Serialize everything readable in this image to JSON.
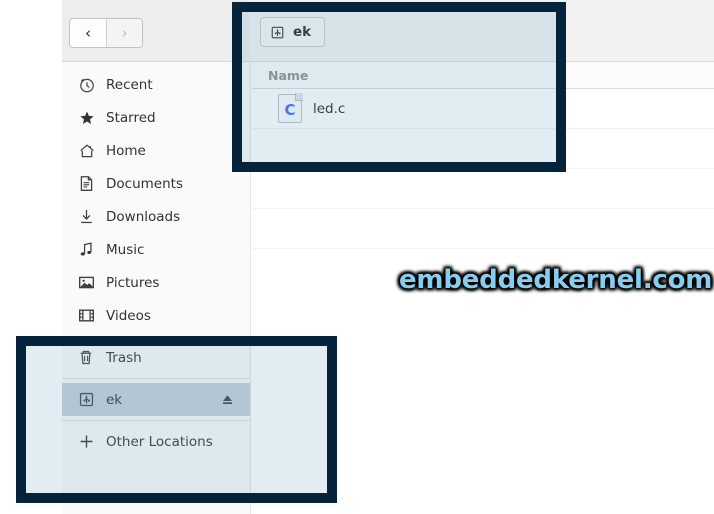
{
  "window": {
    "toolbar": {
      "back_label": "‹",
      "forward_label": "›",
      "back_icon": "chevron-left-icon",
      "forward_icon": "chevron-right-icon"
    }
  },
  "sidebar": {
    "items": [
      {
        "label": "Recent",
        "icon": "clock-icon"
      },
      {
        "label": "Starred",
        "icon": "star-icon"
      },
      {
        "label": "Home",
        "icon": "home-icon"
      },
      {
        "label": "Documents",
        "icon": "document-icon"
      },
      {
        "label": "Downloads",
        "icon": "download-icon"
      },
      {
        "label": "Music",
        "icon": "music-note-icon"
      },
      {
        "label": "Pictures",
        "icon": "image-icon"
      },
      {
        "label": "Videos",
        "icon": "film-icon"
      },
      {
        "label": "Trash",
        "icon": "trash-icon"
      },
      {
        "label": "ek",
        "icon": "usb-drive-icon",
        "selected": true,
        "action_icon": "eject-icon"
      },
      {
        "label": "Other Locations",
        "icon": "plus-icon"
      }
    ]
  },
  "main": {
    "path_button": {
      "label": "ek",
      "icon": "usb-drive-icon"
    },
    "column_header": "Name",
    "files": [
      {
        "name": "led.c",
        "icon": "c-source-file-icon",
        "icon_letter": "C"
      }
    ]
  },
  "watermark": {
    "text": "embeddedkernel.com",
    "color": "#86cdf0"
  },
  "highlights": [
    {
      "name": "path-and-file-list-highlight",
      "color": "#05233b"
    },
    {
      "name": "sidebar-device-highlight",
      "color": "#05233b"
    }
  ]
}
